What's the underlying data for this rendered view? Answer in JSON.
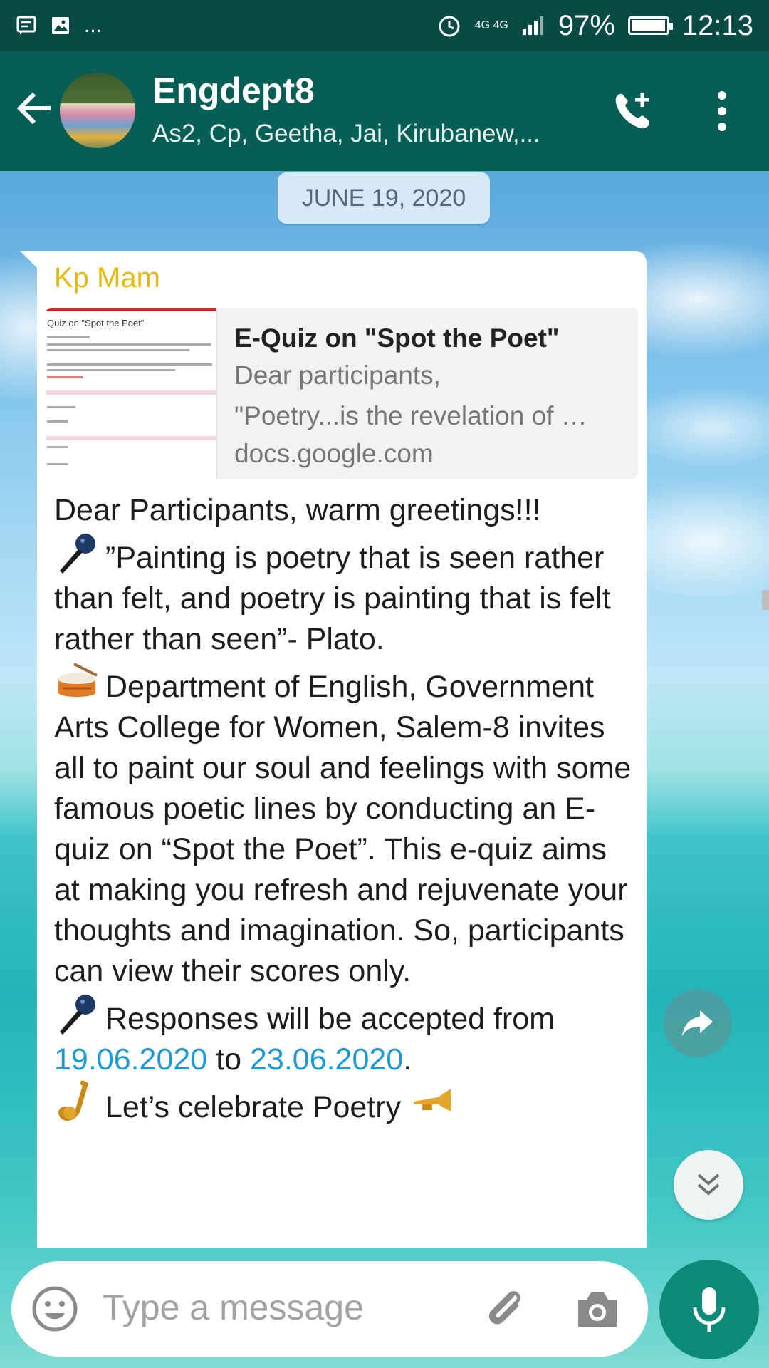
{
  "status_bar": {
    "network_label": "4G 4G",
    "battery_percent_text": "97%",
    "battery_level": 0.97,
    "time": "12:13",
    "overflow_indicator": "..."
  },
  "header": {
    "title": "Engdept8",
    "members": "As2, Cp, Geetha, Jai, Kirubanew,...",
    "icons": [
      "back-arrow-icon",
      "group-avatar",
      "add-call-icon",
      "more-vert-icon"
    ]
  },
  "date_chip": "JUNE 19, 2020",
  "message": {
    "sender": "Kp Mam",
    "link_preview": {
      "thumb_title": "Quiz on \"Spot the Poet\"",
      "title": "E-Quiz on \"Spot the Poet\"",
      "desc_line1": "Dear participants,",
      "desc_line2": "\"Poetry...is the revelation of …",
      "domain": "docs.google.com"
    },
    "greeting": "Dear Participants, warm greetings!!!",
    "quote": "”Painting is poetry that is seen rather than felt, and poetry is painting that is felt rather than seen”- Plato.",
    "body1": "Department of English, Government Arts College for Women, Salem-8 invites all to paint our soul and feelings with some famous poetic lines by conducting an E-quiz on “Spot the Poet”. This e-quiz aims at making you refresh and rejuvenate your thoughts and imagination. So, participants can view their scores only.",
    "responses_prefix": "Responses will be accepted from",
    "date_from": "19.06.2020",
    "to_word": " to ",
    "date_to": "23.06.2020",
    "period": ".",
    "celebrate": "Let’s celebrate Poetry",
    "emojis": [
      "microphone-emoji",
      "drum-emoji",
      "microphone-emoji",
      "saxophone-emoji",
      "trumpet-emoji"
    ]
  },
  "input": {
    "placeholder": "Type a message"
  },
  "colors": {
    "status_bar": "#0a4a44",
    "toolbar": "#075e54",
    "sender": "#e5b80f",
    "link": "#1a9bd8",
    "mic_button": "#0a8a77",
    "date_chip": "#d6e9f5"
  }
}
